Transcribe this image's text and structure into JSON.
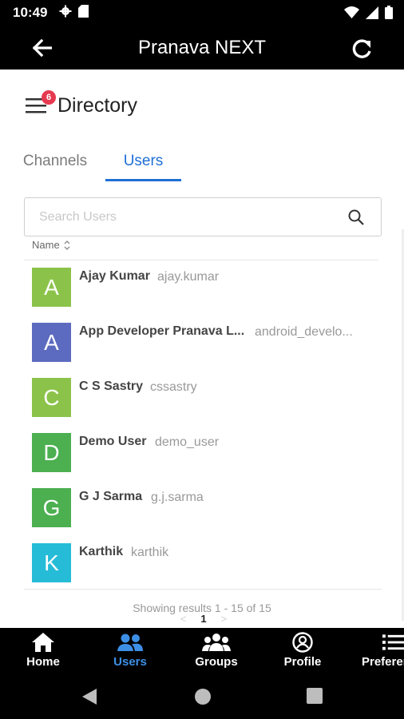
{
  "status_bar": {
    "time": "10:49"
  },
  "app_bar": {
    "title": "Pranava NEXT",
    "back_icon": "arrow-left-icon",
    "refresh_icon": "refresh-icon"
  },
  "directory": {
    "title": "Directory",
    "badge_count": "6"
  },
  "tabs": [
    {
      "label": "Channels",
      "active": false
    },
    {
      "label": "Users",
      "active": true
    }
  ],
  "search": {
    "placeholder": "Search Users",
    "value": ""
  },
  "table": {
    "column_name": "Name"
  },
  "users": [
    {
      "initial": "A",
      "name": "Ajay Kumar",
      "username": "ajay.kumar",
      "color": "#8bc34a"
    },
    {
      "initial": "A",
      "name": "App Developer Pranava L...",
      "username": "android_develo...",
      "color": "#5c6bc0"
    },
    {
      "initial": "C",
      "name": "C S Sastry",
      "username": "cssastry",
      "color": "#8bc34a"
    },
    {
      "initial": "D",
      "name": "Demo User",
      "username": "demo_user",
      "color": "#4caf50"
    },
    {
      "initial": "G",
      "name": "G J Sarma",
      "username": "g.j.sarma",
      "color": "#4caf50"
    },
    {
      "initial": "K",
      "name": "Karthik",
      "username": "karthik",
      "color": "#26bcd7"
    }
  ],
  "pagination": {
    "results_text": "Showing results 1 - 15 of 15",
    "prev": "<",
    "current_page": "1",
    "next": ">"
  },
  "bottom_nav": [
    {
      "label": "Home",
      "icon": "home-icon",
      "active": false
    },
    {
      "label": "Users",
      "icon": "users-icon",
      "active": true
    },
    {
      "label": "Groups",
      "icon": "groups-icon",
      "active": false
    },
    {
      "label": "Profile",
      "icon": "profile-icon",
      "active": false
    },
    {
      "label": "Preferences",
      "icon": "list-icon",
      "active": false
    }
  ],
  "colors": {
    "accent": "#1f6fd6",
    "nav_active": "#3d8fe6",
    "badge": "#e63950"
  }
}
